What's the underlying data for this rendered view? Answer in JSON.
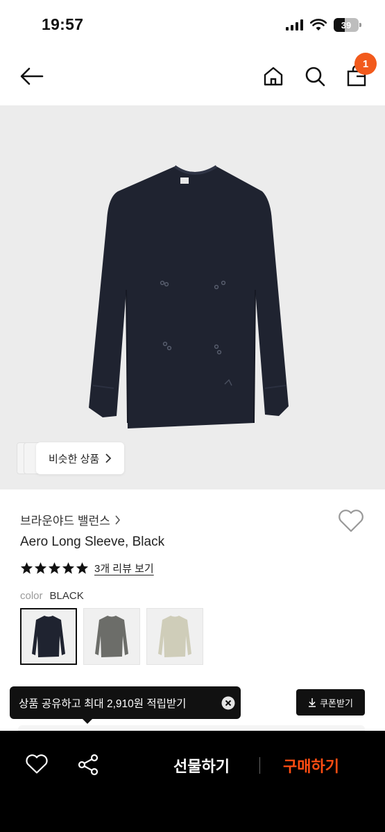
{
  "status_bar": {
    "time": "19:57",
    "battery": "39"
  },
  "nav": {
    "cart_badge": "1"
  },
  "hero": {
    "similar_label": "비슷한 상품"
  },
  "product": {
    "brand": "브라운야드 밸런스",
    "name": "Aero Long Sleeve, Black",
    "rating_stars": 5,
    "review_link": "3개 리뷰 보기",
    "color_label": "color",
    "color_value": "BLACK"
  },
  "swatches": [
    {
      "name": "black",
      "color": "#1f2330"
    },
    {
      "name": "gray",
      "color": "#6c6d69"
    },
    {
      "name": "beige",
      "color": "#cfcdb9"
    }
  ],
  "coupon": {
    "label": "쿠폰받기"
  },
  "tooltip": {
    "text": "상품 공유하고 최대 2,910원 적립받기"
  },
  "bottom_bar": {
    "gift_label": "선물하기",
    "buy_label": "구매하기"
  },
  "colors": {
    "accent": "#f25a1c",
    "buy": "#ff4d12",
    "bar": "#000000"
  }
}
